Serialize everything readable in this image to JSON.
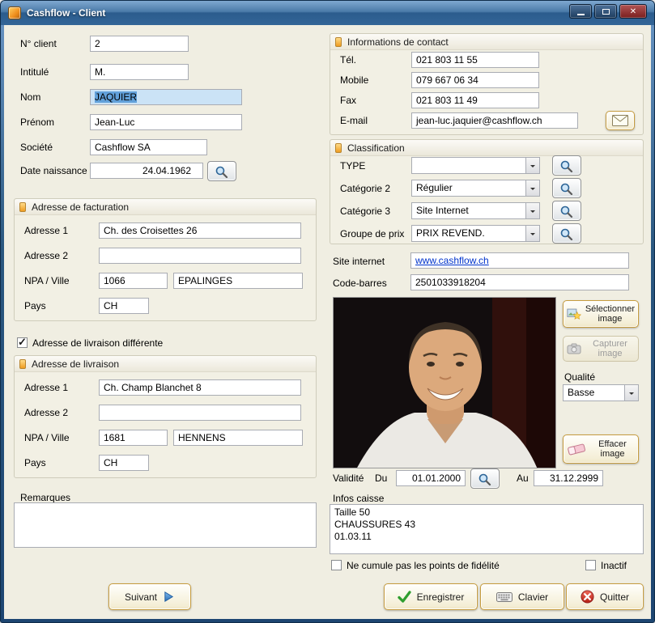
{
  "window": {
    "title": "Cashflow - Client"
  },
  "person": {
    "no_client": {
      "label": "N° client",
      "value": "2"
    },
    "intitule": {
      "label": "Intitulé",
      "value": "M."
    },
    "nom": {
      "label": "Nom",
      "value": "JAQUIER"
    },
    "prenom": {
      "label": "Prénom",
      "value": "Jean-Luc"
    },
    "societe": {
      "label": "Société",
      "value": "Cashflow SA"
    },
    "date_naissance": {
      "label": "Date naissance",
      "value": "24.04.1962"
    }
  },
  "adresse_facturation": {
    "title": "Adresse de facturation",
    "adresse1": {
      "label": "Adresse 1",
      "value": "Ch. des Croisettes 26"
    },
    "adresse2": {
      "label": "Adresse 2",
      "value": ""
    },
    "npa_ville": {
      "label": "NPA / Ville",
      "npa": "1066",
      "ville": "EPALINGES"
    },
    "pays": {
      "label": "Pays",
      "value": "CH"
    }
  },
  "livraison_differente": {
    "label": "Adresse de livraison différente",
    "checked": true
  },
  "adresse_livraison": {
    "title": "Adresse de livraison",
    "adresse1": {
      "label": "Adresse 1",
      "value": "Ch. Champ Blanchet 8"
    },
    "adresse2": {
      "label": "Adresse 2",
      "value": ""
    },
    "npa_ville": {
      "label": "NPA / Ville",
      "npa": "1681",
      "ville": "HENNENS"
    },
    "pays": {
      "label": "Pays",
      "value": "CH"
    }
  },
  "remarques": {
    "label": "Remarques",
    "value": ""
  },
  "contact": {
    "title": "Informations de contact",
    "tel": {
      "label": "Tél.",
      "value": "021 803 11 55"
    },
    "mobile": {
      "label": "Mobile",
      "value": "079 667 06 34"
    },
    "fax": {
      "label": "Fax",
      "value": "021 803 11 49"
    },
    "email": {
      "label": "E-mail",
      "value": "jean-luc.jaquier@cashflow.ch"
    }
  },
  "classification": {
    "title": "Classification",
    "type": {
      "label": "TYPE",
      "value": ""
    },
    "categorie2": {
      "label": "Catégorie 2",
      "value": "Régulier"
    },
    "categorie3": {
      "label": "Catégorie 3",
      "value": "Site Internet"
    },
    "groupe_prix": {
      "label": "Groupe de prix",
      "value": "PRIX REVEND."
    }
  },
  "site_internet": {
    "label": "Site internet",
    "value": "www.cashflow.ch"
  },
  "code_barres": {
    "label": "Code-barres",
    "value": "2501033918204"
  },
  "image_panel": {
    "selectionner": "Sélectionner image",
    "capturer": "Capturer image",
    "qualite_label": "Qualité",
    "qualite_value": "Basse",
    "effacer": "Effacer image"
  },
  "validite": {
    "label": "Validité",
    "du_label": "Du",
    "du_value": "01.01.2000",
    "au_label": "Au",
    "au_value": "31.12.2999"
  },
  "infos_caisse": {
    "label": "Infos caisse",
    "value": "Taille 50\nCHAUSSURES 43\n01.03.11"
  },
  "options": {
    "fidelite": {
      "label": "Ne cumule pas les points de fidélité",
      "checked": false
    },
    "inactif": {
      "label": "Inactif",
      "checked": false
    }
  },
  "footer": {
    "suivant": "Suivant",
    "enregistrer": "Enregistrer",
    "clavier": "Clavier",
    "quitter": "Quitter"
  },
  "colors": {
    "accent_gold": "#c69c3e",
    "titlebar_top": "#7fa8d0",
    "titlebar_bottom": "#336597",
    "selection": "#62a1da",
    "link_blue": "#0033cc"
  }
}
